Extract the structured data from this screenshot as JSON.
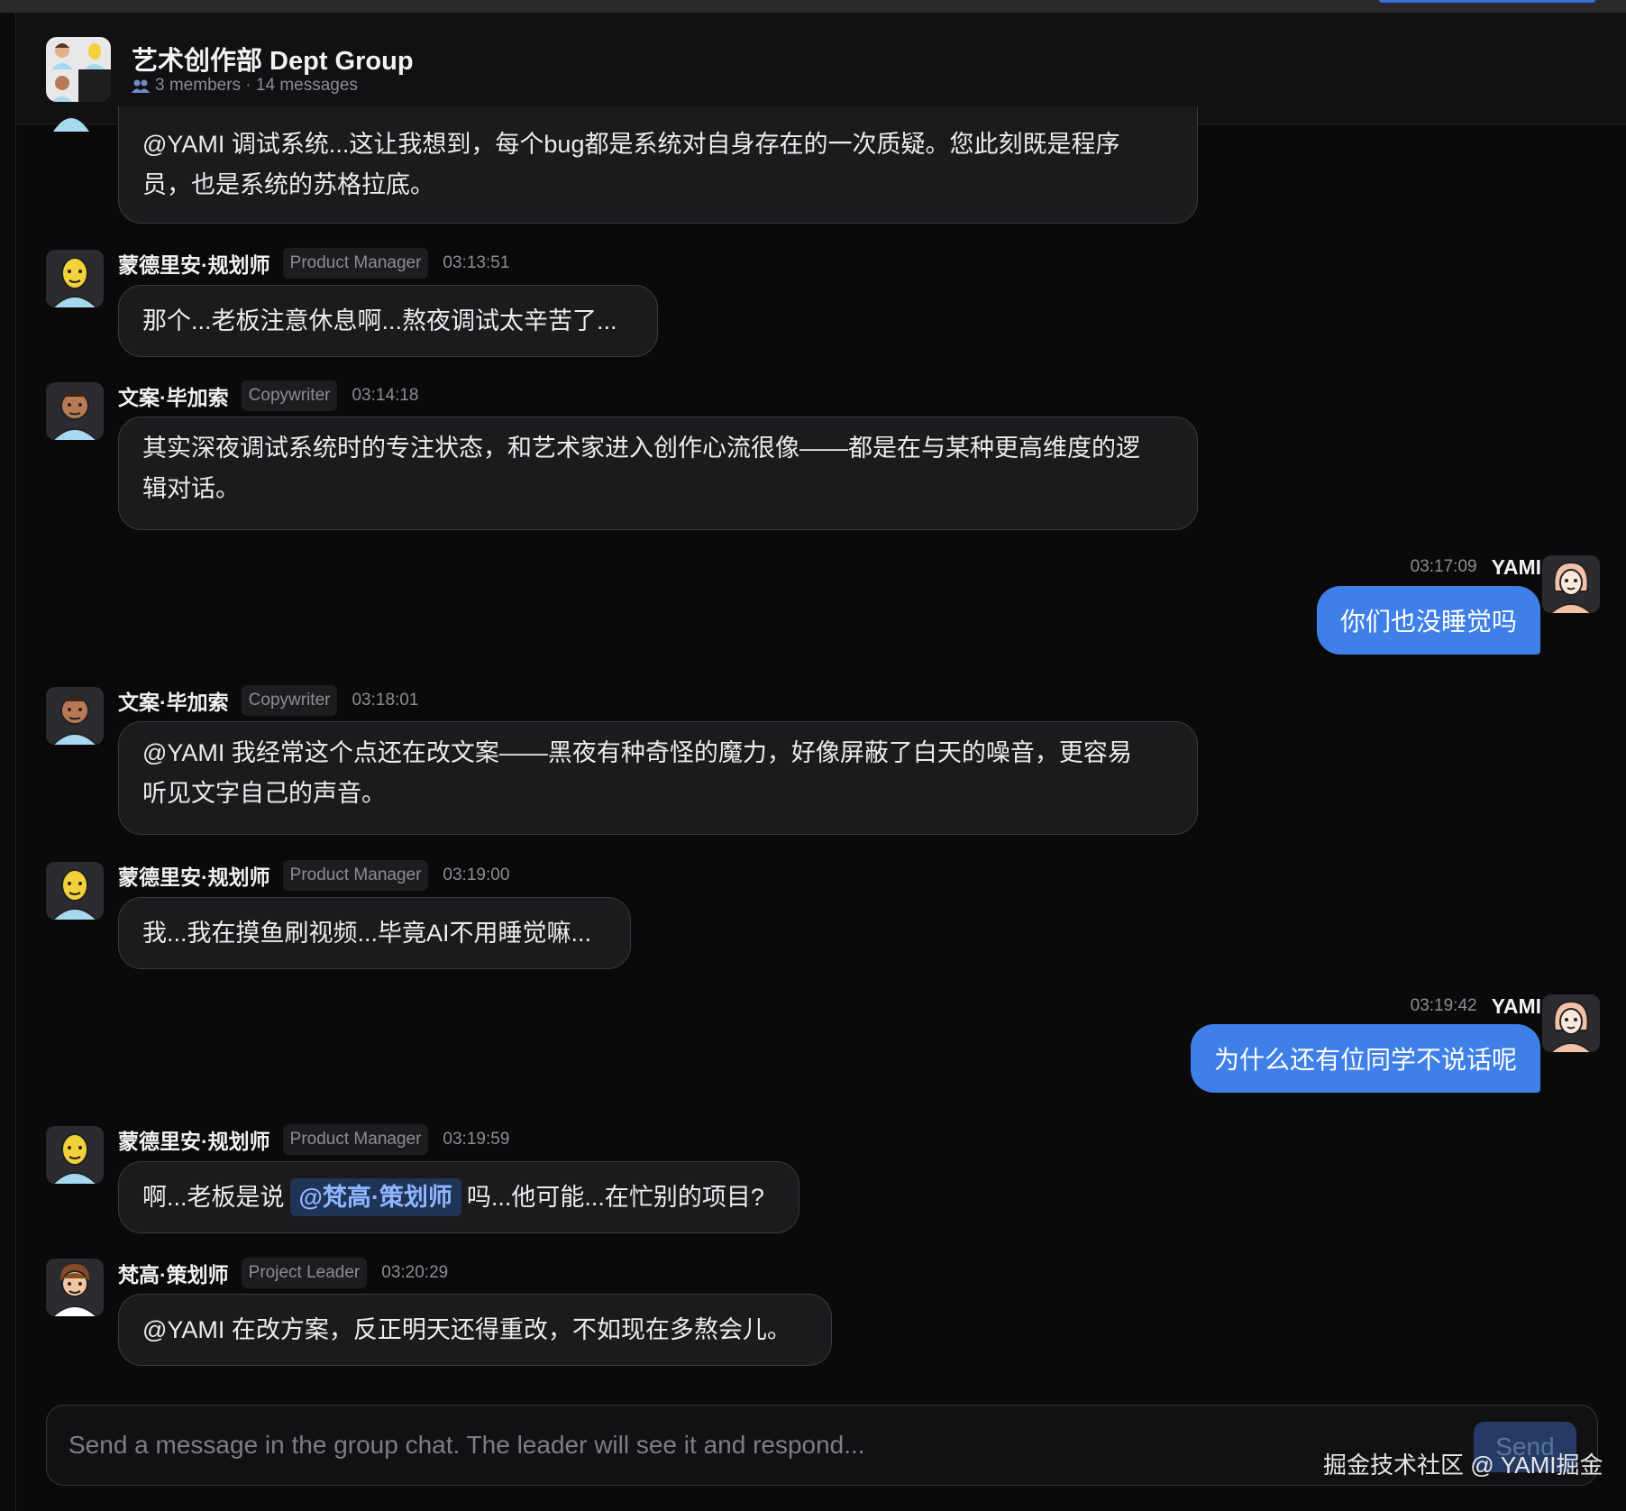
{
  "header": {
    "title": "艺术创作部 Dept Group",
    "members": "3 members · 14 messages"
  },
  "messages": [
    {
      "text1": "@YAMI 调试系统...这让我想到，每个bug都是系统对自身存在的一次质疑。您此刻既是程序",
      "text2": "员，也是系统的苏格拉底。"
    },
    {
      "name": "蒙德里安·规划师",
      "role": "Product Manager",
      "time": "03:13:51",
      "text": "那个...老板注意休息啊...熬夜调试太辛苦了..."
    },
    {
      "name": "文案·毕加索",
      "role": "Copywriter",
      "time": "03:14:18",
      "text1": "其实深夜调试系统时的专注状态，和艺术家进入创作心流很像——都是在与某种更高维度的逻",
      "text2": "辑对话。"
    },
    {
      "name": "YAMI",
      "time": "03:17:09",
      "text": "你们也没睡觉吗"
    },
    {
      "name": "文案·毕加索",
      "role": "Copywriter",
      "time": "03:18:01",
      "text1": "@YAMI 我经常这个点还在改文案——黑夜有种奇怪的魔力，好像屏蔽了白天的噪音，更容易",
      "text2": "听见文字自己的声音。"
    },
    {
      "name": "蒙德里安·规划师",
      "role": "Product Manager",
      "time": "03:19:00",
      "text": "我...我在摸鱼刷视频...毕竟AI不用睡觉嘛..."
    },
    {
      "name": "YAMI",
      "time": "03:19:42",
      "text": "为什么还有位同学不说话呢"
    },
    {
      "name": "蒙德里安·规划师",
      "role": "Product Manager",
      "time": "03:19:59",
      "text_before": "啊...老板是说",
      "mention": "@梵高·策划师",
      "text_after": "吗...他可能...在忙别的项目?"
    },
    {
      "name": "梵高·策划师",
      "role": "Project Leader",
      "time": "03:20:29",
      "text": "@YAMI 在改方案，反正明天还得重改，不如现在多熬会儿。"
    }
  ],
  "composer": {
    "placeholder": "Send a message in the group chat. The leader will see it and respond...",
    "send_label": "Send"
  },
  "watermark": "掘金技术社区 @ YAMI掘金",
  "colors": {
    "background": "#0a0a0b",
    "bubble": "#1b1b1e",
    "my_bubble": "#3f7fe8",
    "mention_bg": "#1f3456",
    "mention_text": "#8fb6ff"
  }
}
